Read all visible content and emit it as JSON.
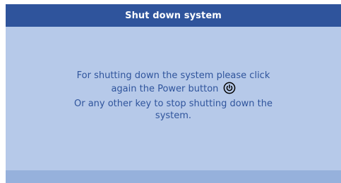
{
  "dialog": {
    "title": "Shut down system",
    "line1": "For shutting down the system please click",
    "line2": "again the Power button",
    "line3": "Or any other key to stop shutting down the",
    "line4": "system.",
    "power_icon": "power-icon"
  },
  "colors": {
    "title_bar": "#2f549c",
    "body_background": "#b6c9e9",
    "footer_bar": "#96b1dc",
    "text": "#2f549c"
  }
}
